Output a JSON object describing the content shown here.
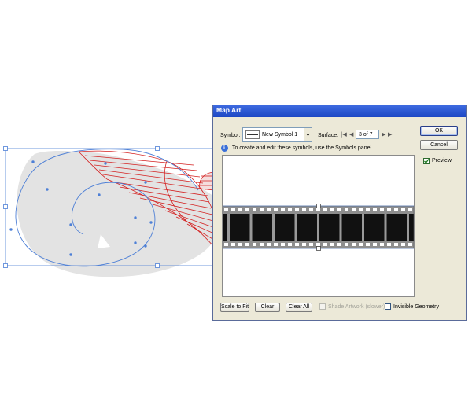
{
  "dialog": {
    "title": "Map Art",
    "symbol_label": "Symbol:",
    "symbol_value": "New Symbol 1",
    "surface_label": "Surface:",
    "surface_value": "3 of 7",
    "info_text": "To create and edit these symbols, use the Symbols panel.",
    "ok_label": "OK",
    "cancel_label": "Cancel",
    "preview_label": "Preview",
    "preview_checked": true,
    "scale_to_fit_label": "Scale to Fit",
    "clear_label": "Clear",
    "clear_all_label": "Clear All",
    "shade_artwork_label": "Shade Artwork (slower)",
    "shade_artwork_checked": false,
    "shade_artwork_enabled": false,
    "invisible_geometry_label": "Invisible Geometry",
    "invisible_geometry_checked": false
  },
  "colors": {
    "accent_titlebar": "#1c47c4",
    "selection_blue": "#4d7fd6",
    "wireframe_red": "#d42020",
    "shape_gray": "#e3e3e3"
  }
}
